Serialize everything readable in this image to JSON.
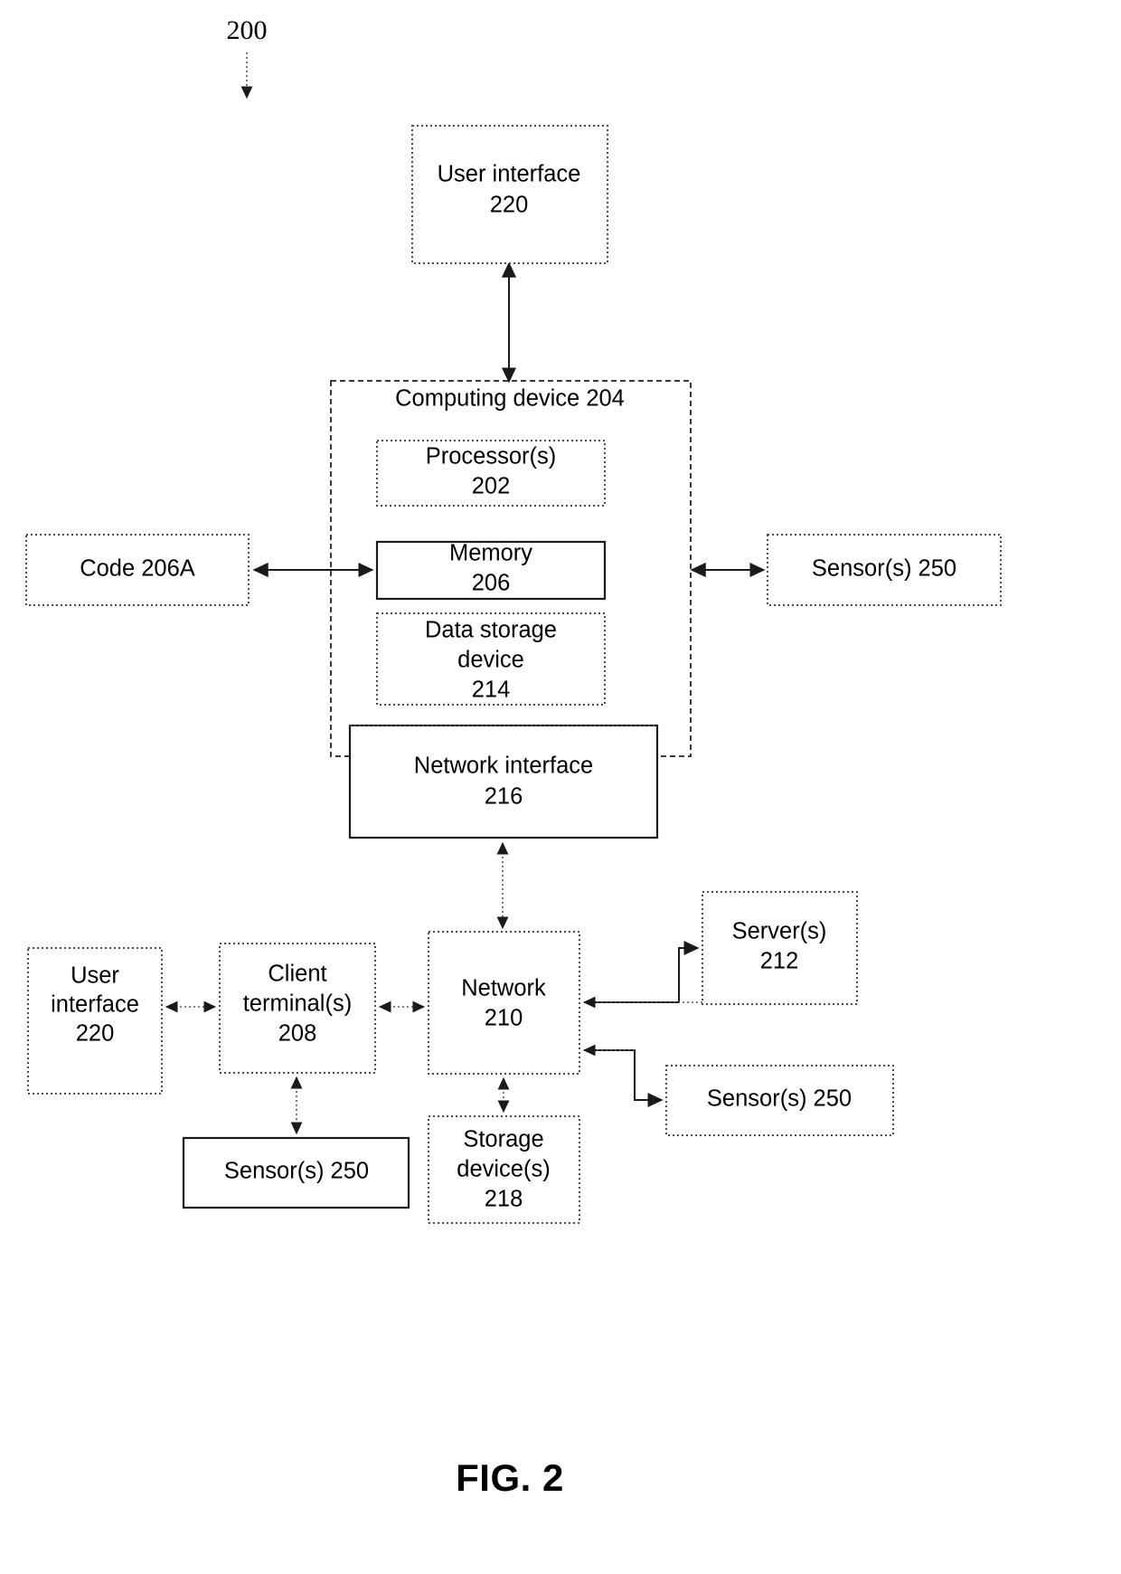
{
  "figure": {
    "reference_numeral": "200",
    "caption": "FIG. 2"
  },
  "boxes": {
    "user_interface_top": {
      "line1": "User interface",
      "line2": "220"
    },
    "computing_device": {
      "title": "Computing device 204"
    },
    "processor": {
      "line1": "Processor(s)",
      "line2": "202"
    },
    "memory": {
      "line1": "Memory",
      "line2": "206"
    },
    "data_storage_device": {
      "line1": "Data storage",
      "line2": "device",
      "line3": "214"
    },
    "network_interface": {
      "line1": "Network interface",
      "line2": "216"
    },
    "code": {
      "line1": "Code 206A"
    },
    "sensors_right": {
      "line1": "Sensor(s) 250"
    },
    "user_interface_bottom": {
      "line1": "User",
      "line2": "interface",
      "line3": "220"
    },
    "client_terminal": {
      "line1": "Client",
      "line2": "terminal(s)",
      "line3": "208"
    },
    "network": {
      "line1": "Network",
      "line2": "210"
    },
    "servers": {
      "line1": "Server(s)",
      "line2": "212"
    },
    "sensors_network": {
      "line1": "Sensor(s) 250"
    },
    "sensors_client": {
      "line1": "Sensor(s) 250"
    },
    "storage_devices": {
      "line1": "Storage",
      "line2": "device(s)",
      "line3": "218"
    }
  },
  "colors": {
    "line": "#1a1a1a",
    "dotted_line": "#4a4a4a",
    "background": "#ffffff",
    "text": "#000000"
  }
}
